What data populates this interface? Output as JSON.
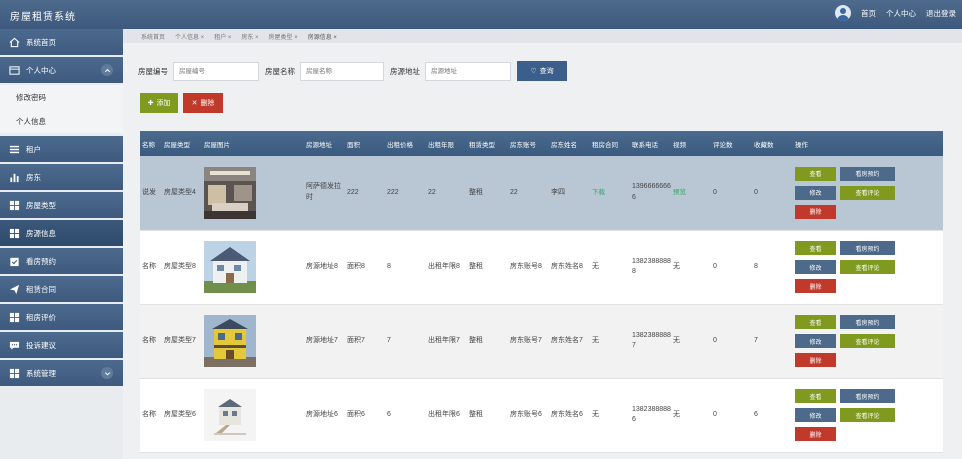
{
  "app": {
    "title": "房屋租赁系统"
  },
  "topnav": {
    "home": "首页",
    "personal": "个人中心",
    "logout": "退出登录"
  },
  "sidebar": {
    "items": [
      {
        "label": "系统首页",
        "icon": "home-icon"
      },
      {
        "label": "个人中心",
        "icon": "id-card-icon",
        "expanded": true
      },
      {
        "label": "租户",
        "icon": "list-icon"
      },
      {
        "label": "房东",
        "icon": "bar-chart-icon"
      },
      {
        "label": "房屋类型",
        "icon": "grid-icon"
      },
      {
        "label": "房源信息",
        "icon": "grid-icon",
        "active": true
      },
      {
        "label": "看房预约",
        "icon": "calendar-check-icon"
      },
      {
        "label": "租赁合同",
        "icon": "paper-plane-icon"
      },
      {
        "label": "租房评价",
        "icon": "grid-icon"
      },
      {
        "label": "投诉建议",
        "icon": "chat-icon"
      },
      {
        "label": "系统管理",
        "icon": "grid-icon"
      }
    ],
    "sub_items": [
      "修改密码",
      "个人信息"
    ]
  },
  "breadcrumb": [
    "系统首页",
    "个人信息 ×",
    "租户 ×",
    "房东 ×",
    "房屋类型 ×",
    "房源信息 ×"
  ],
  "search": {
    "fields": [
      {
        "label": "房屋编号",
        "placeholder": "房屋编号"
      },
      {
        "label": "房屋名称",
        "placeholder": "房屋名称"
      },
      {
        "label": "房源地址",
        "placeholder": "房源地址"
      }
    ],
    "button": "查询"
  },
  "actions": {
    "add": "添加",
    "delete": "删除"
  },
  "table": {
    "headers": [
      "名称",
      "房屋类型",
      "房屋图片",
      "房源地址",
      "面积",
      "出租价格",
      "出租年限",
      "租赁类型",
      "房东账号",
      "房东姓名",
      "租房合同",
      "联系电话",
      "视频",
      "评论数",
      "收藏数",
      "操作"
    ],
    "rows": [
      {
        "name": "说发",
        "type": "房屋类型4",
        "image": "interior-room",
        "address": "阿萨德发拉时",
        "area": "222",
        "price": "222",
        "years": "22",
        "lease": "整租",
        "account": "22",
        "owner": "李四",
        "contract": "下载",
        "phone": "13966666666",
        "video": "预览"
      },
      {
        "name": "名称",
        "type": "房屋类型8",
        "image": "villa",
        "address": "房源地址8",
        "area": "面积8",
        "price": "8",
        "years": "出租年限8",
        "lease": "整租",
        "account": "房东账号8",
        "owner": "房东姓名8",
        "contract": "无",
        "phone": "13823888888",
        "video": "无",
        "comments": "0",
        "favorites": "8"
      },
      {
        "name": "名称",
        "type": "房屋类型7",
        "image": "yellow-house",
        "address": "房源地址7",
        "area": "面积7",
        "price": "7",
        "years": "出租年限7",
        "lease": "整租",
        "account": "房东账号7",
        "owner": "房东姓名7",
        "contract": "无",
        "phone": "13823888887",
        "video": "无",
        "comments": "0",
        "favorites": "7"
      },
      {
        "name": "名称",
        "type": "房屋类型6",
        "image": "small-house",
        "address": "房源地址6",
        "area": "面积6",
        "price": "6",
        "years": "出租年限6",
        "lease": "整租",
        "account": "房东账号6",
        "owner": "房东姓名6",
        "contract": "无",
        "phone": "13823888886",
        "video": "无",
        "comments": "0",
        "favorites": "6"
      }
    ],
    "first_row_counts": {
      "comments": "0",
      "favorites": "0"
    },
    "op_labels": {
      "view": "查看",
      "booking": "看房预约",
      "edit": "修改",
      "review": "查看评论",
      "delete": "删除"
    }
  },
  "colors": {
    "header": "#3d5a7e",
    "green": "#7f9a1f",
    "red": "#c0392b",
    "steel": "#4e6a8b"
  }
}
